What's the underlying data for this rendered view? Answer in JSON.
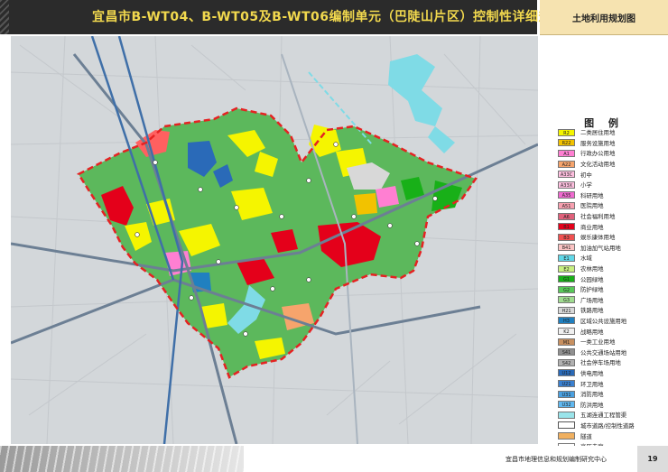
{
  "header": {
    "title": "宜昌市B-WT04、B-WT05及B-WT06编制单元（巴陡山片区）控制性详细规划",
    "map_name": "土地利用规划图"
  },
  "legend": {
    "title": "图 例",
    "items": [
      {
        "code": "R2",
        "label": "二类居住用地",
        "color": "#f5f500"
      },
      {
        "code": "R22",
        "label": "服务设施用地",
        "color": "#f2c200"
      },
      {
        "code": "A1",
        "label": "行政办公用地",
        "color": "#ff7fd2"
      },
      {
        "code": "A22",
        "label": "文化活动用地",
        "color": "#f6a46c"
      },
      {
        "code": "A33C",
        "label": "初中",
        "color": "#ffc0e0"
      },
      {
        "code": "A33X",
        "label": "小学",
        "color": "#ffc0e0"
      },
      {
        "code": "A35",
        "label": "科研用地",
        "color": "#f06ad0"
      },
      {
        "code": "A51",
        "label": "医院用地",
        "color": "#f7a0b0"
      },
      {
        "code": "A6",
        "label": "社会福利用地",
        "color": "#e0607a"
      },
      {
        "code": "B1",
        "label": "商业用地",
        "color": "#e4001a"
      },
      {
        "code": "B3",
        "label": "娱乐康体用地",
        "color": "#f05050"
      },
      {
        "code": "B41",
        "label": "加油加气站用地",
        "color": "#fbc3c3"
      },
      {
        "code": "E1",
        "label": "水域",
        "color": "#60d8e8"
      },
      {
        "code": "E2",
        "label": "农林用地",
        "color": "#c8f080"
      },
      {
        "code": "G1",
        "label": "公园绿地",
        "color": "#18b018"
      },
      {
        "code": "G2",
        "label": "防护绿地",
        "color": "#58c858"
      },
      {
        "code": "G3",
        "label": "广场用地",
        "color": "#a0dc90"
      },
      {
        "code": "H21",
        "label": "铁路用地",
        "color": "#d8d8d8"
      },
      {
        "code": "H3",
        "label": "区域公共设施用地",
        "color": "#2080c0"
      },
      {
        "code": "K2",
        "label": "战略用地",
        "color": "#f0f0f0"
      },
      {
        "code": "M1",
        "label": "一类工业用地",
        "color": "#c89060"
      },
      {
        "code": "S41",
        "label": "公共交通场站用地",
        "color": "#909090"
      },
      {
        "code": "S42",
        "label": "社会停车场用地",
        "color": "#b0b0b0"
      },
      {
        "code": "U12",
        "label": "供电用地",
        "color": "#2a6ab8"
      },
      {
        "code": "U21",
        "label": "环卫用地",
        "color": "#3a80d0"
      },
      {
        "code": "U31",
        "label": "消防用地",
        "color": "#4aa0e0"
      },
      {
        "code": "U32",
        "label": "防洪用地",
        "color": "#60b8f0"
      },
      {
        "code": "",
        "label": "五湖连通工程管渠",
        "color": "#9ae4ea"
      },
      {
        "code": "",
        "label": "城市道路/控制性道路",
        "color": "#ffffff"
      },
      {
        "code": "",
        "label": "隧道",
        "color": "#f0b060"
      },
      {
        "code": "",
        "label": "高压走廊",
        "color": "#ffffff"
      },
      {
        "code": "",
        "label": "规划范围",
        "color": "#ffffff"
      }
    ]
  },
  "footer": {
    "organization": "宜昌市地理信息和规划编制研究中心",
    "page_number": "19"
  },
  "colors": {
    "header_background": "#2b2b2b",
    "title_color": "#f2d94e",
    "map_name_background": "#f6e3b0",
    "boundary_red": "#e52222",
    "base_map_grey": "#d7dbde"
  }
}
